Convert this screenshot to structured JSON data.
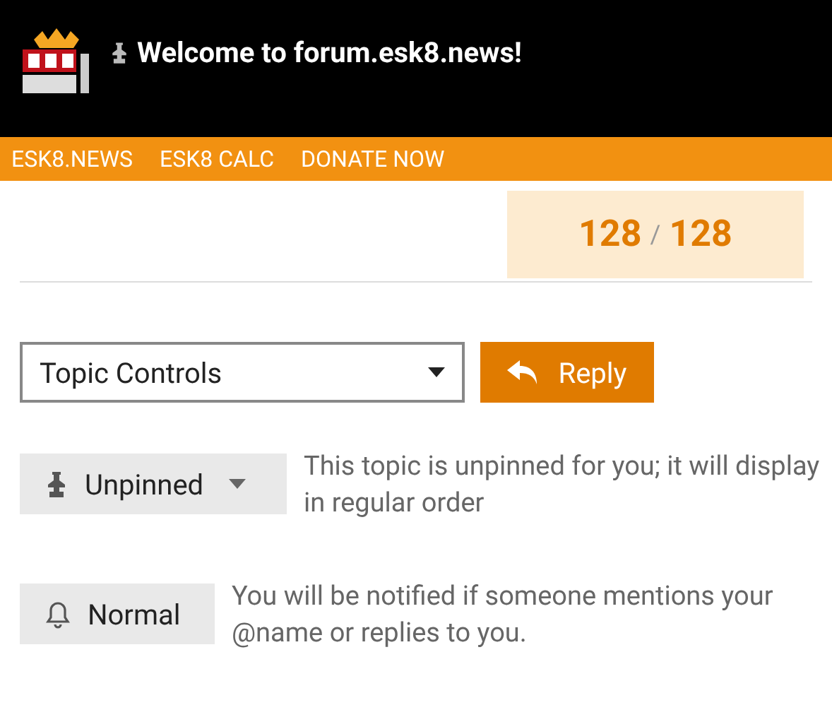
{
  "header": {
    "title": "Welcome to forum.esk8.news!"
  },
  "nav": [
    "ESK8.NEWS",
    "ESK8 CALC",
    "DONATE NOW"
  ],
  "progress": {
    "current": "128",
    "separator": "/",
    "total": "128"
  },
  "topic_controls": {
    "label": "Topic Controls"
  },
  "reply_button": {
    "label": "Reply"
  },
  "statuses": [
    {
      "kind": "pin",
      "label": "Unpinned",
      "description": "This topic is unpinned for you; it will display in regular order"
    },
    {
      "kind": "notification",
      "label": "Normal",
      "description": "You will be notified if someone mentions your @name or replies to you."
    }
  ]
}
